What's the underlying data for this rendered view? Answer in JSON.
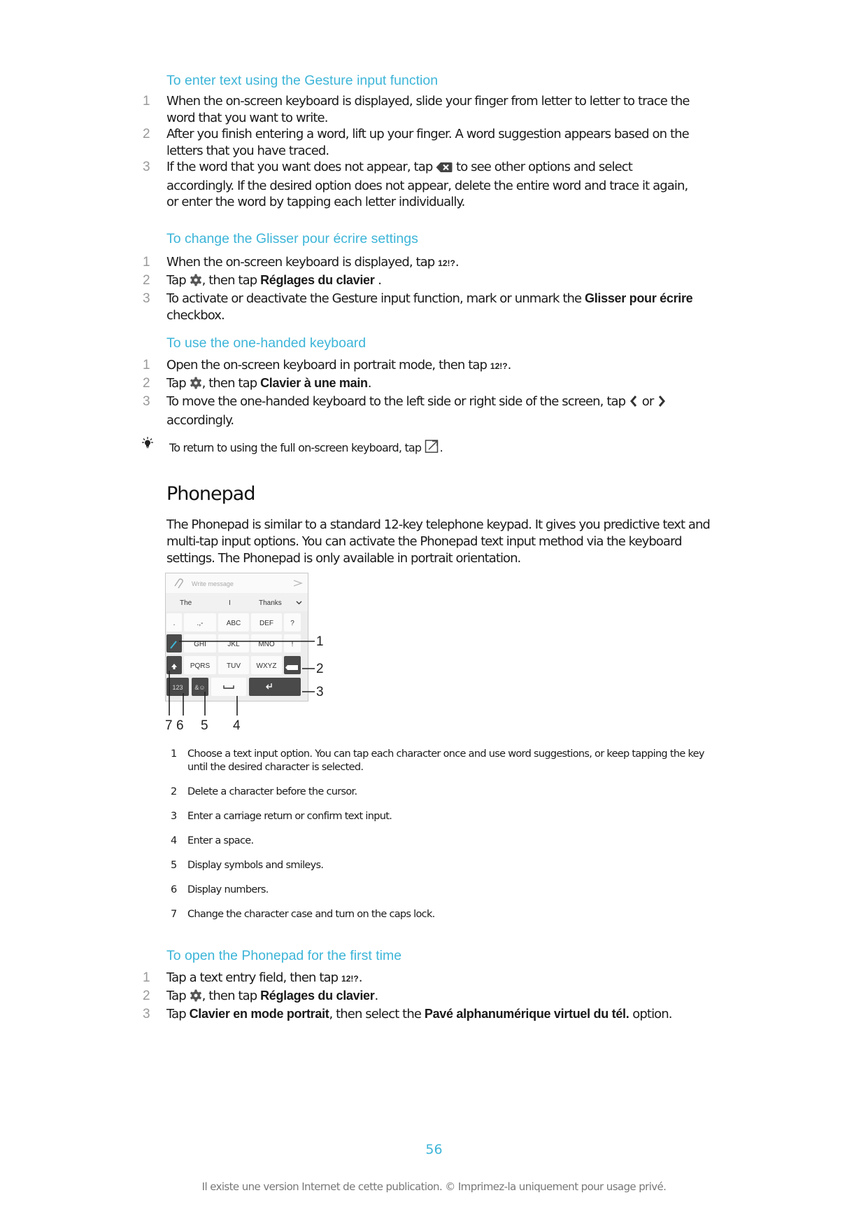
{
  "sections": [
    {
      "heading": "To enter text using the Gesture input function",
      "steps": [
        {
          "num": "1",
          "text": "When the on-screen keyboard is displayed, slide your finger from letter to letter to trace the word that you want to write."
        },
        {
          "num": "2",
          "text": "After you finish entering a word, lift up your finger. A word suggestion appears based on the letters that you have traced."
        },
        {
          "num": "3",
          "pre": "If the word that you want does not appear, tap",
          "icon": "backspace-icon",
          "post": "to see other options and select accordingly. If the desired option does not appear, delete the entire word and trace it again, or enter the word by tapping each letter individually."
        }
      ]
    },
    {
      "heading": "To change the Glisser pour écrire settings",
      "steps": [
        {
          "num": "1",
          "pre": "When the on-screen keyboard is displayed, tap",
          "code": "12!?",
          "post": "."
        },
        {
          "num": "2",
          "pre": "Tap",
          "icon": "gear-icon",
          "mid": ", then tap",
          "bold": "Réglages du clavier",
          "post": " ."
        },
        {
          "num": "3",
          "pre": "To activate or deactivate the Gesture input function, mark or unmark the",
          "bold": "Glisser pour écrire",
          "post": "checkbox."
        }
      ]
    },
    {
      "heading": "To use the one-handed keyboard",
      "steps": [
        {
          "num": "1",
          "pre": "Open the on-screen keyboard in portrait mode, then tap",
          "code": "12!?",
          "post": "."
        },
        {
          "num": "2",
          "pre": "Tap",
          "icon": "gear-icon",
          "mid": ", then tap",
          "bold": "Clavier à une main",
          "post": "."
        },
        {
          "num": "3",
          "pre": "To move the one-handed keyboard to the left side or right side of the screen, tap",
          "icon_left": "chevron-left-icon",
          "or": "or",
          "icon_right": "chevron-right-icon",
          "post": "accordingly."
        }
      ]
    }
  ],
  "tip": {
    "icon": "lightbulb-icon",
    "pre": "To return to using the full on-screen keyboard, tap",
    "icon_inline": "expand-icon",
    "post": "."
  },
  "phonepad": {
    "title": "Phonepad",
    "paragraph": "The Phonepad is similar to a standard 12-key telephone keypad. It gives you predictive text and multi-tap input options. You can activate the Phonepad text input method via the keyboard settings. The Phonepad is only available in portrait orientation.",
    "figure": {
      "message_placeholder": "Write message",
      "suggestions": [
        "The",
        "I",
        "Thanks"
      ],
      "rows": [
        [
          ".",
          ".,-",
          "ABC",
          "DEF",
          "?"
        ],
        [
          "",
          "GHI",
          "JKL",
          "MNO",
          "!"
        ],
        [
          "",
          "PQRS",
          "TUV",
          "WXYZ",
          ""
        ],
        [
          "123",
          "&☺",
          "",
          ""
        ]
      ],
      "callouts_right": [
        "1",
        "2",
        "3"
      ],
      "callouts_bottom": [
        "7",
        "6",
        "5",
        "4"
      ]
    },
    "legend": [
      {
        "num": "1",
        "text": "Choose a text input option. You can tap each character once and use word suggestions, or keep tapping the key until the desired character is selected."
      },
      {
        "num": "2",
        "text": "Delete a character before the cursor."
      },
      {
        "num": "3",
        "text": "Enter a carriage return or confirm text input."
      },
      {
        "num": "4",
        "text": "Enter a space."
      },
      {
        "num": "5",
        "text": "Display symbols and smileys."
      },
      {
        "num": "6",
        "text": "Display numbers."
      },
      {
        "num": "7",
        "text": "Change the character case and turn on the caps lock."
      }
    ]
  },
  "open_phonepad": {
    "heading": "To open the Phonepad for the first time",
    "steps": [
      {
        "num": "1",
        "pre": "Tap a text entry field, then tap",
        "code": "12!?",
        "post": "."
      },
      {
        "num": "2",
        "pre": "Tap",
        "icon": "gear-icon",
        "mid": ", then tap",
        "bold": "Réglages du clavier",
        "post": "."
      },
      {
        "num": "3",
        "pre": "Tap",
        "bold": "Clavier en mode portrait",
        "mid": ", then select the",
        "bold2": "Pavé alphanumérique virtuel du tél.",
        "post": "option."
      }
    ]
  },
  "page_number": "56",
  "footer": "Il existe une version Internet de cette publication. © Imprimez-la uniquement pour usage privé.",
  "colors": {
    "accent": "#3db5d8",
    "step_number": "#999999",
    "footer": "#777777"
  }
}
